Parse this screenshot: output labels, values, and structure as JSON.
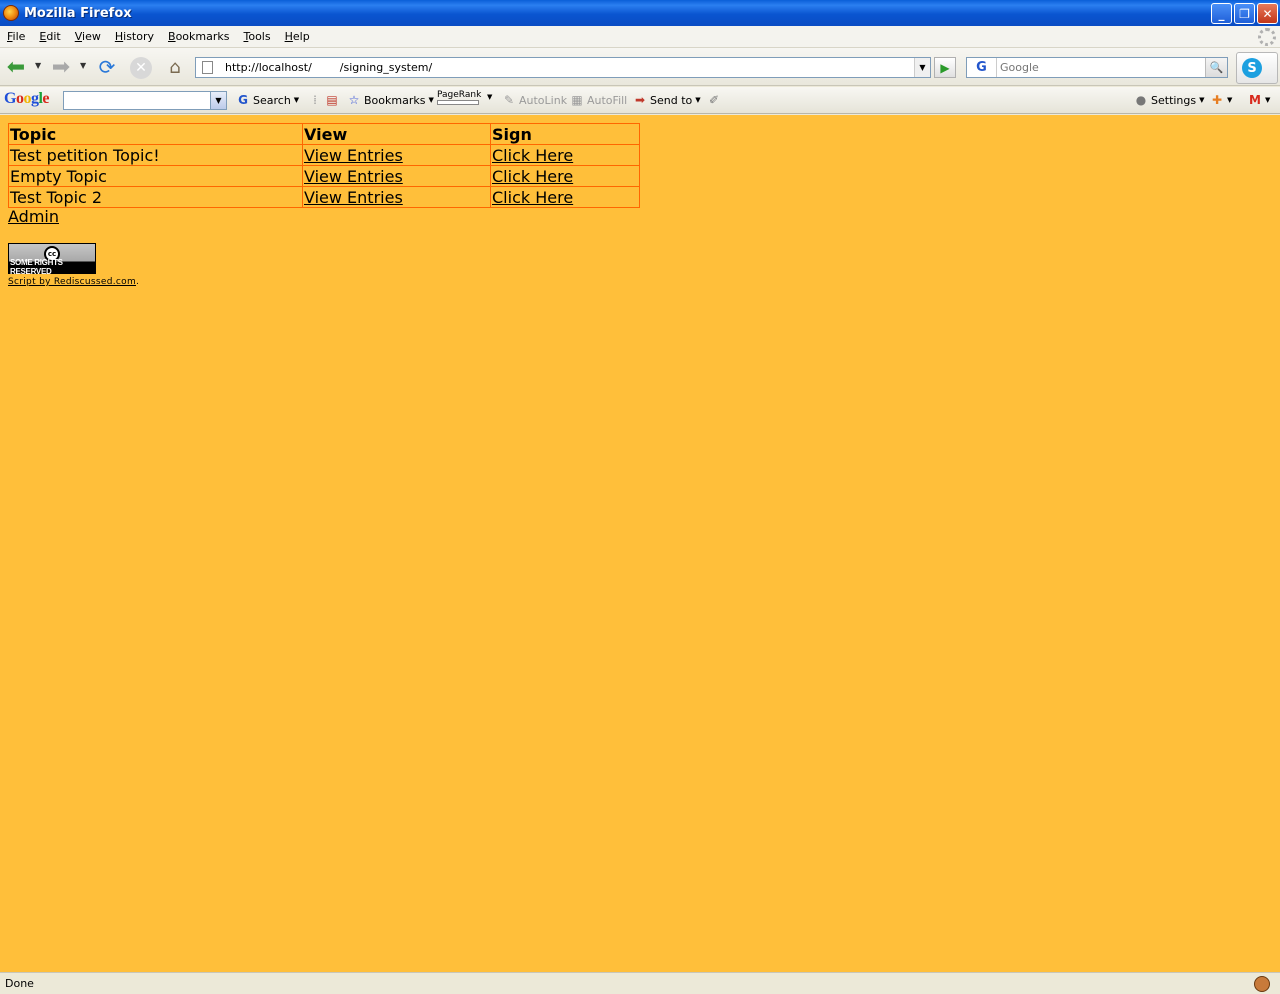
{
  "window": {
    "title": "Mozilla Firefox"
  },
  "menu": {
    "items": [
      {
        "key": "F",
        "rest": "ile"
      },
      {
        "key": "E",
        "rest": "dit"
      },
      {
        "key": "V",
        "rest": "iew"
      },
      {
        "key": "H",
        "rest": "istory"
      },
      {
        "key": "B",
        "rest": "ookmarks"
      },
      {
        "key": "T",
        "rest": "ools"
      },
      {
        "key": "H",
        "rest": "elp"
      }
    ]
  },
  "nav": {
    "url": "http://localhost/        /signing_system/",
    "search_placeholder": "Google",
    "search_engine": "G"
  },
  "google_toolbar": {
    "logo": "Google",
    "search_label": "Search",
    "bookmarks_label": "Bookmarks",
    "pagerank_label": "PageRank",
    "autolink_label": "AutoLink",
    "autofill_label": "AutoFill",
    "sendto_label": "Send to",
    "settings_label": "Settings"
  },
  "page": {
    "table": {
      "headers": [
        "Topic",
        "View",
        "Sign"
      ],
      "rows": [
        {
          "topic": "Test petition Topic!",
          "view": "View Entries",
          "sign": "Click Here"
        },
        {
          "topic": "Empty Topic",
          "view": "View Entries",
          "sign": "Click Here"
        },
        {
          "topic": "Test Topic 2",
          "view": "View Entries",
          "sign": "Click Here"
        }
      ]
    },
    "admin_link": "Admin",
    "cc_badge": "SOME RIGHTS RESERVED",
    "credit_link": "Script by Rediscussed.com",
    "credit_suffix": "."
  },
  "colors": {
    "page_background": "#ffbf3a",
    "table_border": "#ff6600"
  },
  "status": {
    "text": "Done"
  }
}
